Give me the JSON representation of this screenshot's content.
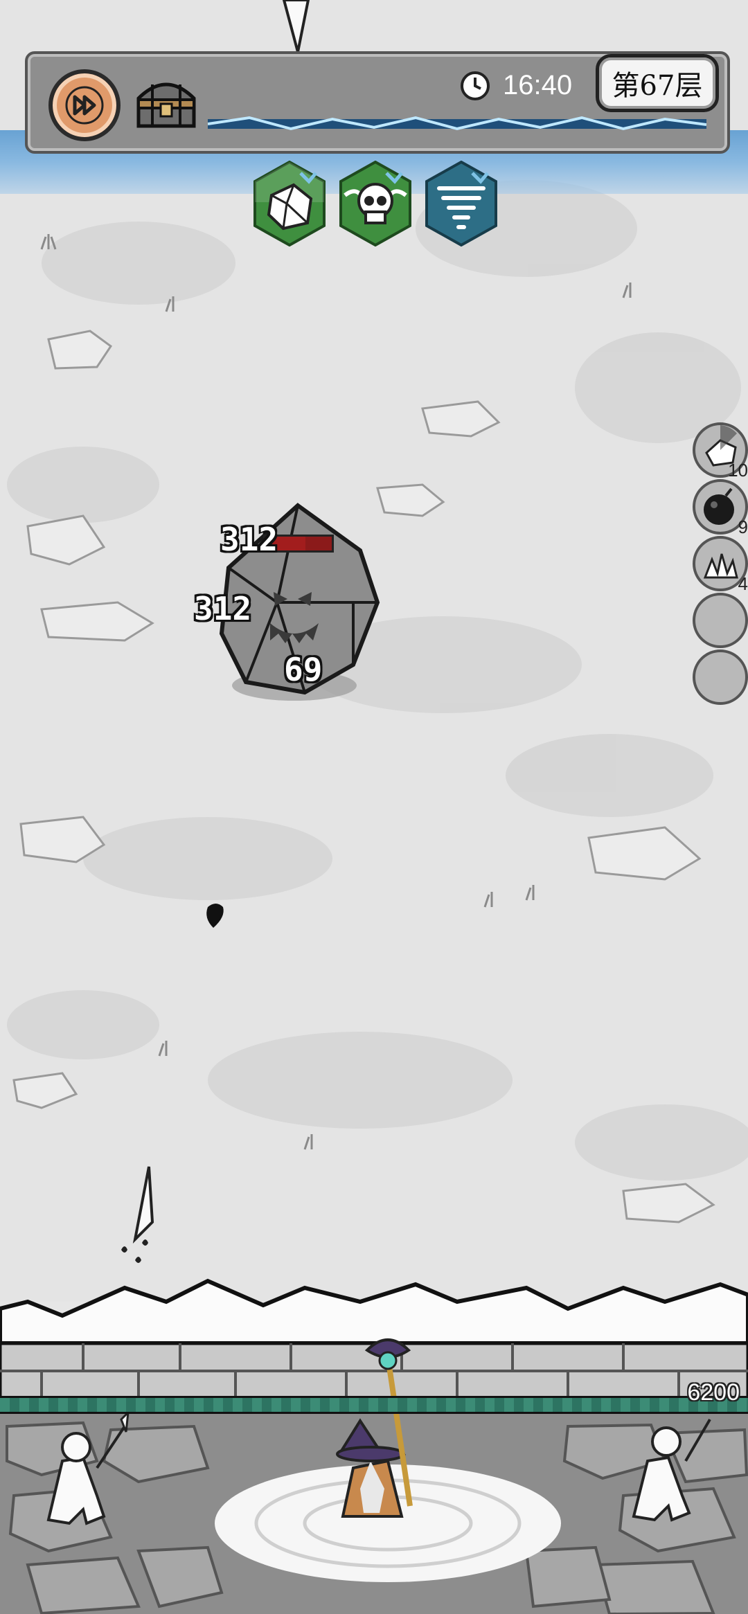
{
  "hud": {
    "fast_forward_icon": "fast-forward-icon",
    "chest_icon": "treasure-chest-icon",
    "clock_icon": "clock-icon",
    "time": "16:40",
    "floor": "第67层"
  },
  "skills": [
    {
      "icon": "crystal-rock-icon",
      "color": "#3f8f3f"
    },
    {
      "icon": "winged-skull-icon",
      "color": "#3f8f3f"
    },
    {
      "icon": "tornado-icon",
      "color": "#2d6e86"
    }
  ],
  "buffs": [
    {
      "icon": "crystal-rock-icon",
      "count": "10"
    },
    {
      "icon": "bomb-icon",
      "count": "9"
    },
    {
      "icon": "ice-shards-icon",
      "count": "4"
    },
    {
      "icon": "empty-slot",
      "count": ""
    },
    {
      "icon": "empty-slot",
      "count": ""
    }
  ],
  "enemy": {
    "type": "rock-golem",
    "damage_numbers": [
      "312",
      "312",
      "69"
    ],
    "hp_fraction": 0.6
  },
  "wall": {
    "hp": "6200",
    "hp_fraction": 1.0
  }
}
